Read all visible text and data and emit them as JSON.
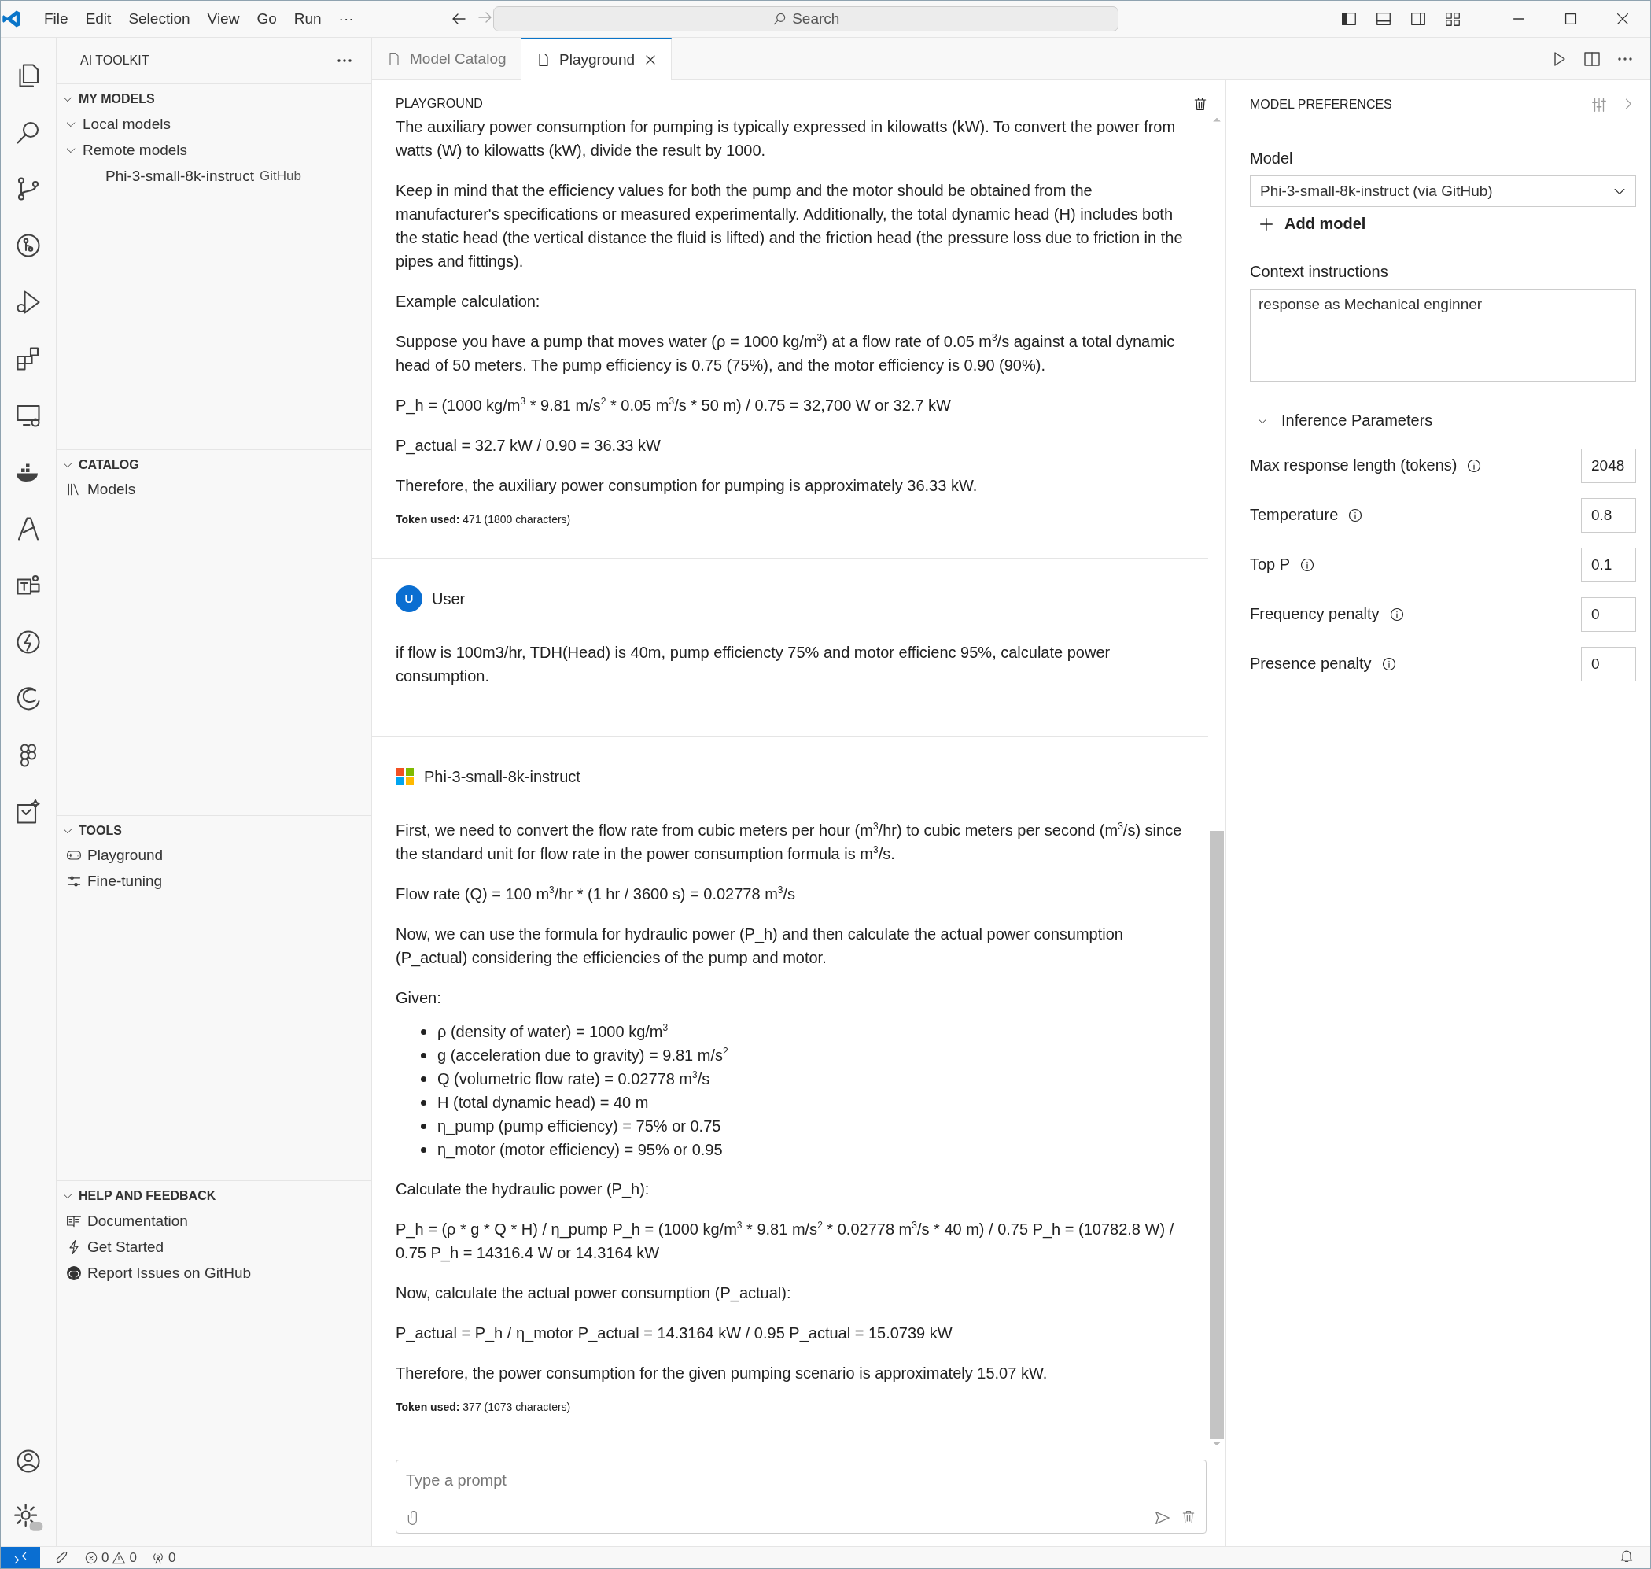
{
  "menu": [
    "File",
    "Edit",
    "Selection",
    "View",
    "Go",
    "Run",
    "···"
  ],
  "search": {
    "placeholder": "Search"
  },
  "sidebar": {
    "title": "AI TOOLKIT",
    "sections": [
      {
        "title": "MY MODELS",
        "expanded": true,
        "items": [
          {
            "label": "Local models",
            "expanded": true
          },
          {
            "label": "Remote models",
            "expanded": true,
            "children": [
              {
                "label": "Phi-3-small-8k-instruct",
                "badge": "GitHub"
              }
            ]
          }
        ]
      },
      {
        "title": "CATALOG",
        "expanded": true,
        "items": [
          {
            "label": "Models"
          }
        ]
      },
      {
        "title": "TOOLS",
        "expanded": true,
        "items": [
          {
            "label": "Playground"
          },
          {
            "label": "Fine-tuning"
          }
        ]
      },
      {
        "title": "HELP AND FEEDBACK",
        "expanded": true,
        "items": [
          {
            "label": "Documentation"
          },
          {
            "label": "Get Started"
          },
          {
            "label": "Report Issues on GitHub"
          }
        ]
      }
    ]
  },
  "tabs": [
    {
      "label": "Model Catalog",
      "selected": false
    },
    {
      "label": "Playground",
      "selected": true
    }
  ],
  "playground": {
    "title": "PLAYGROUND",
    "messages": [
      {
        "kind": "assistant",
        "blocks": [
          {
            "kind": "p",
            "text": "The auxiliary power consumption for pumping is typically expressed in kilowatts (kW). To convert the power from watts (W) to kilowatts (kW), divide the result by 1000."
          },
          {
            "kind": "p",
            "text": "Keep in mind that the efficiency values for both the pump and the motor should be obtained from the manufacturer's specifications or measured experimentally. Additionally, the total dynamic head (H) includes both the static head (the vertical distance the fluid is lifted) and the friction head (the pressure loss due to friction in the pipes and fittings)."
          },
          {
            "kind": "p",
            "text": "Example calculation:"
          },
          {
            "kind": "p",
            "text": "Suppose you have a pump that moves water (ρ = 1000 kg/m$^{3}$) at a flow rate of 0.05 m$^{3}$/s against a total dynamic head of 50 meters. The pump efficiency is 0.75 (75%), and the motor efficiency is 0.90 (90%)."
          },
          {
            "kind": "p",
            "text": "P_h = (1000 kg/m$^{3}$ * 9.81 m/s$^{2}$ * 0.05 m$^{3}$/s * 50 m) / 0.75 = 32,700 W or 32.7 kW"
          },
          {
            "kind": "p",
            "text": "P_actual = 32.7 kW / 0.90 = 36.33 kW"
          },
          {
            "kind": "p",
            "text": "Therefore, the auxiliary power consumption for pumping is approximately 36.33 kW."
          }
        ],
        "tokens": "**Token used:** 471 (1800 characters)"
      },
      {
        "kind": "user",
        "avatar": "U",
        "name": "User",
        "blocks": [
          {
            "kind": "p",
            "text": "if flow is 100m3/hr, TDH(Head) is 40m, pump efficiencty 75% and motor efficienc 95%, calculate power consumption."
          }
        ]
      },
      {
        "kind": "assistant",
        "name": "Phi-3-small-8k-instruct",
        "blocks": [
          {
            "kind": "p",
            "text": "First, we need to convert the flow rate from cubic meters per hour (m$^{3}$/hr) to cubic meters per second (m$^{3}$/s) since the standard unit for flow rate in the power consumption formula is m$^{3}$/s."
          },
          {
            "kind": "p",
            "text": "Flow rate (Q) = 100 m$^{3}$/hr * (1 hr / 3600 s) = 0.02778 m$^{3}$/s"
          },
          {
            "kind": "p",
            "text": "Now, we can use the formula for hydraulic power (P_h) and then calculate the actual power consumption (P_actual) considering the efficiencies of the pump and motor."
          },
          {
            "kind": "p",
            "text": "Given:"
          },
          {
            "kind": "list",
            "items": [
              "ρ (density of water) = 1000 kg/m$^{3}$",
              "g (acceleration due to gravity) = 9.81 m/s$^{2}$",
              "Q (volumetric flow rate) = 0.02778 m$^{3}$/s",
              "H (total dynamic head) = 40 m",
              "η_pump (pump efficiency) = 75% or 0.75",
              "η_motor (motor efficiency) = 95% or 0.95"
            ]
          },
          {
            "kind": "p",
            "text": "Calculate the hydraulic power (P_h):"
          },
          {
            "kind": "p",
            "text": "P_h = (ρ * g * Q * H) / η_pump P_h = (1000 kg/m$^{3}$ * 9.81 m/s$^{2}$ * 0.02778 m$^{3}$/s * 40 m) / 0.75 P_h = (10782.8 W) / 0.75 P_h = 14316.4 W or 14.3164 kW"
          },
          {
            "kind": "p",
            "text": "Now, calculate the actual power consumption (P_actual):"
          },
          {
            "kind": "p",
            "text": "P_actual = P_h / η_motor P_actual = 14.3164 kW / 0.95 P_actual = 15.0739 kW"
          },
          {
            "kind": "p",
            "text": "Therefore, the power consumption for the given pumping scenario is approximately 15.07 kW."
          }
        ],
        "tokens": "**Token used:** 377 (1073 characters)"
      }
    ],
    "prompt": {
      "placeholder": "Type a prompt"
    }
  },
  "preferences": {
    "title": "MODEL PREFERENCES",
    "model_label": "Model",
    "model": "Phi-3-small-8k-instruct (via GitHub)",
    "add_model": "Add model",
    "context_label": "Context instructions",
    "context": "response as Mechanical enginner",
    "inference": {
      "title": "Inference Parameters",
      "expanded": true,
      "params": [
        {
          "label": "Max response length (tokens)",
          "value": "2048"
        },
        {
          "label": "Temperature",
          "value": "0.8"
        },
        {
          "label": "Top P",
          "value": "0.1"
        },
        {
          "label": "Frequency penalty",
          "value": "0"
        },
        {
          "label": "Presence penalty",
          "value": "0"
        }
      ]
    }
  },
  "status_bar": {
    "errors": "0",
    "warnings": "0",
    "ports": "0"
  }
}
